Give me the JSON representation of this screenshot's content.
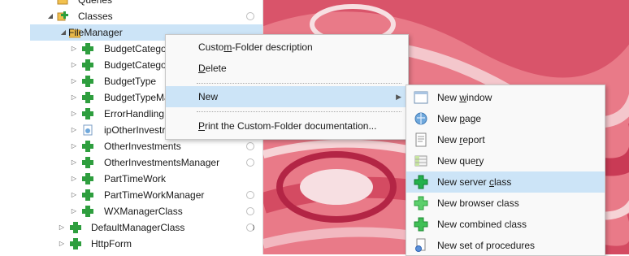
{
  "tree": {
    "queries": "Queries",
    "classes": "Classes",
    "filemanager": "FileManager",
    "items": [
      "BudgetCatego",
      "BudgetCatego",
      "BudgetType",
      "BudgetTypeMa",
      "ErrorHandling",
      "ipOtherInvestr",
      "OtherInvestments",
      "OtherInvestmentsManager",
      "PartTimeWork",
      "PartTimeWorkManager",
      "WXManagerClass"
    ],
    "default_manager": "DefaultManagerClass",
    "httpform": "HttpForm"
  },
  "context_menu": {
    "custom_folder_pre": "Custo",
    "custom_folder_u": "m",
    "custom_folder_post": "-Folder description",
    "delete_u": "D",
    "delete_post": "elete",
    "new": "New",
    "print_u": "P",
    "print_post": "rint the Custom-Folder documentation..."
  },
  "submenu": {
    "window_pre": "New ",
    "window_u": "w",
    "window_post": "indow",
    "page_pre": "New ",
    "page_u": "p",
    "page_post": "age",
    "report_pre": "New ",
    "report_u": "r",
    "report_post": "eport",
    "query_pre": "New que",
    "query_u": "r",
    "query_post": "y",
    "server_pre": "New server ",
    "server_u": "c",
    "server_post": "lass",
    "browser_pre": "New browser class",
    "browser_u": "",
    "browser_post": "",
    "combined_pre": "New combined class",
    "combined_u": "",
    "combined_post": "",
    "procedures_pre": "New set of procedures",
    "procedures_u": "",
    "procedures_post": ""
  },
  "colors": {
    "selection": "#cce4f7",
    "folder": "#e8b84a",
    "class_green": "#2e9e3e",
    "server_class_green": "#22b14c"
  }
}
